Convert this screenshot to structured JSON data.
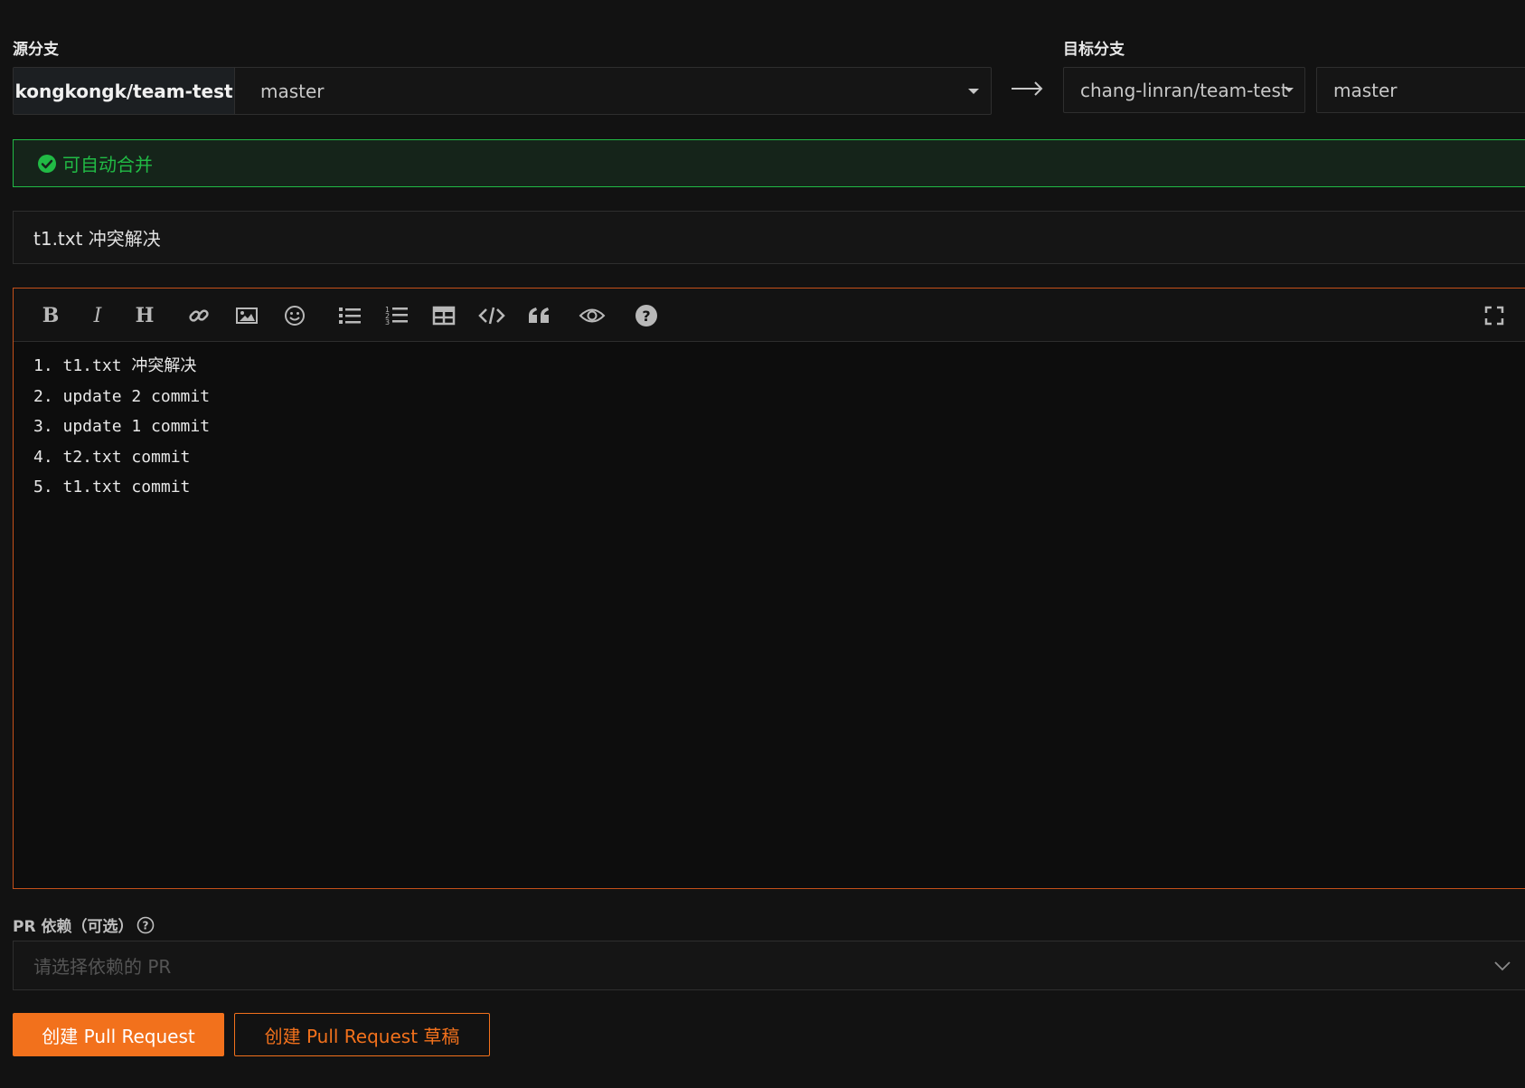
{
  "source_branch": {
    "label": "源分支",
    "repo": "kongkongk/team-test",
    "branch": "master"
  },
  "arrow_icon": "arrow-right-icon",
  "target_branch": {
    "label": "目标分支",
    "repo": "chang-linran/team-test",
    "branch": "master"
  },
  "merge_status": {
    "text": "可自动合并",
    "icon": "check-circle-icon",
    "color": "#21ba45"
  },
  "title_input": {
    "value": "t1.txt 冲突解决"
  },
  "editor": {
    "toolbar": [
      "bold-icon",
      "italic-icon",
      "heading-icon",
      "link-icon",
      "image-icon",
      "emoji-icon",
      "unordered-list-icon",
      "ordered-list-icon",
      "table-icon",
      "code-icon",
      "quote-icon",
      "preview-icon",
      "help-icon",
      "fullscreen-icon"
    ],
    "lines": [
      "1. t1.txt 冲突解决",
      "2. update 2 commit",
      "3. update 1 commit",
      "4. t2.txt commit",
      "5. t1.txt commit"
    ],
    "border_color": "#c4501a"
  },
  "pr_dependency": {
    "label": "PR 依赖（可选）",
    "placeholder": "请选择依赖的 PR"
  },
  "buttons": {
    "create": "创建 Pull Request",
    "create_draft": "创建 Pull Request 草稿"
  },
  "accent_color": "#f2711c"
}
